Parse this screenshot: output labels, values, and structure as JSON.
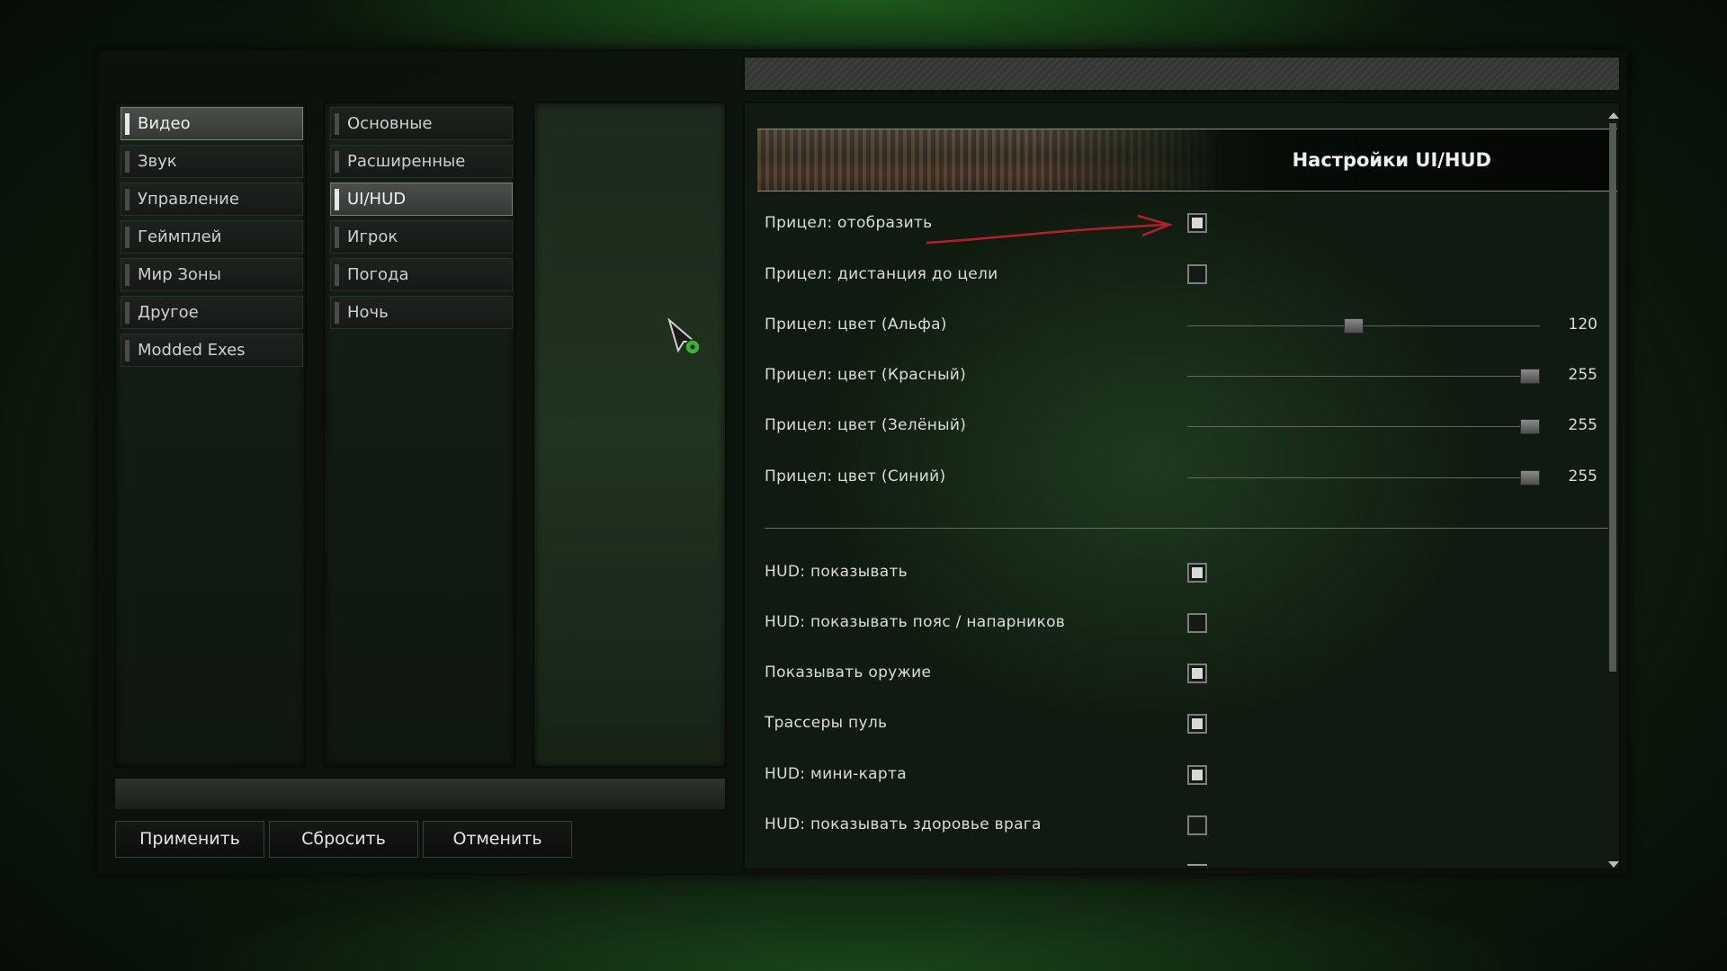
{
  "categories": [
    "Видео",
    "Звук",
    "Управление",
    "Геймплей",
    "Мир Зоны",
    "Другое",
    "Modded Exes"
  ],
  "subcategories": [
    "Основные",
    "Расширенные",
    "UI/HUD",
    "Игрок",
    "Погода",
    "Ночь"
  ],
  "buttons": {
    "apply": "Применить",
    "reset": "Сбросить",
    "cancel": "Отменить"
  },
  "panel": {
    "title": "Настройки UI/HUD",
    "crosshair_rows": [
      {
        "label": "Прицел: отобразить",
        "type": "checkbox",
        "checked": true
      },
      {
        "label": "Прицел: дистанция до цели",
        "type": "checkbox",
        "checked": false
      },
      {
        "label": "Прицел: цвет (Альфа)",
        "type": "slider",
        "value": "120",
        "fraction": 0.47
      },
      {
        "label": "Прицел: цвет (Красный)",
        "type": "slider",
        "value": "255",
        "fraction": 1.0
      },
      {
        "label": "Прицел: цвет (Зелёный)",
        "type": "slider",
        "value": "255",
        "fraction": 1.0
      },
      {
        "label": "Прицел: цвет (Синий)",
        "type": "slider",
        "value": "255",
        "fraction": 1.0
      }
    ],
    "hud_rows": [
      {
        "label": "HUD: показывать",
        "checked": true
      },
      {
        "label": "HUD: показывать пояс / напарников",
        "checked": false
      },
      {
        "label": "Показывать оружие",
        "checked": true
      },
      {
        "label": "Трассеры пуль",
        "checked": true
      },
      {
        "label": "HUD: мини-карта",
        "checked": true
      },
      {
        "label": "HUD: показывать здоровье врага",
        "checked": false
      }
    ]
  },
  "colors": {
    "accent_red_arrow": "#b3202a",
    "cursor_green": "#3fae3a"
  },
  "icons": [
    "scroll-up-icon",
    "scroll-down-icon",
    "mouse-cursor-icon",
    "red-arrow-annotation"
  ]
}
